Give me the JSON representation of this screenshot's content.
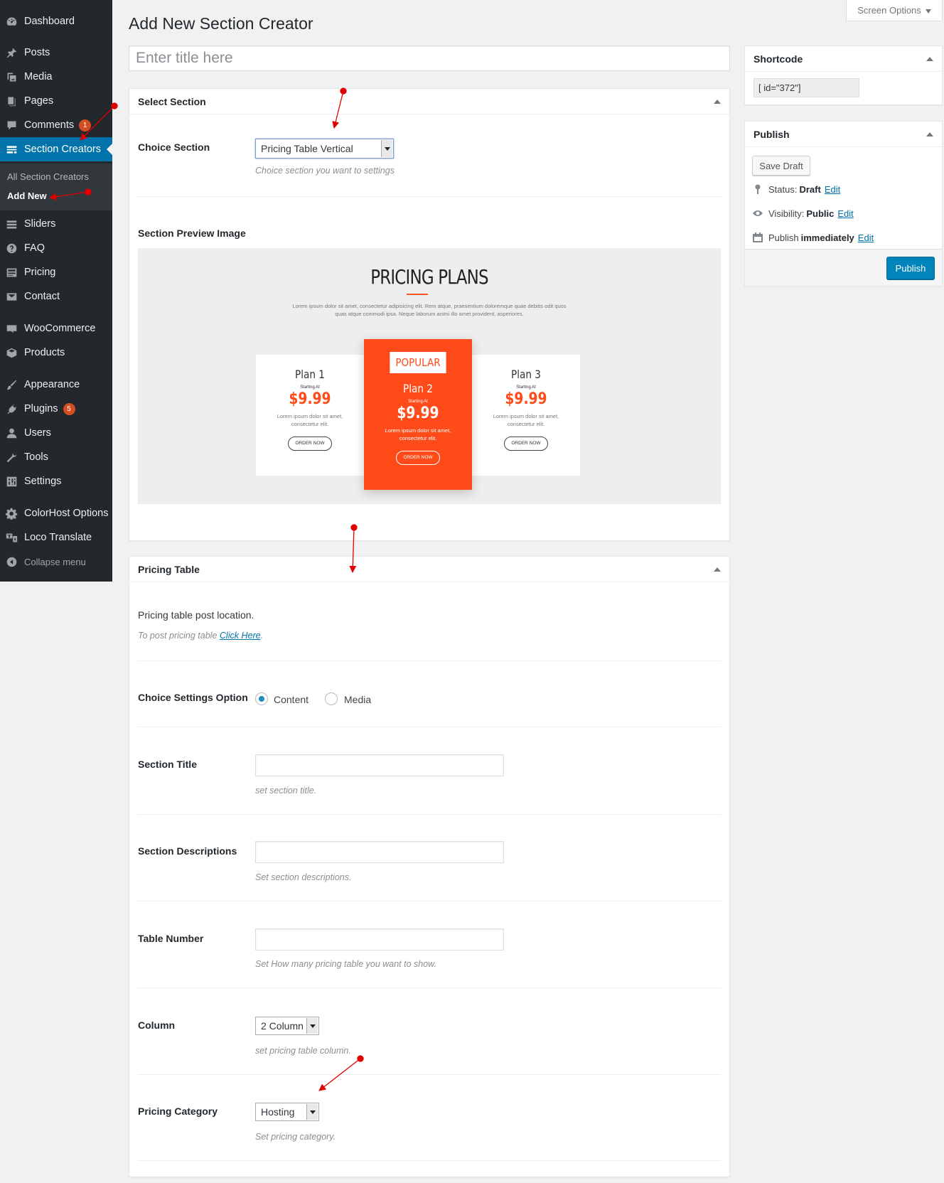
{
  "sidebar": {
    "items": [
      {
        "label": "Dashboard",
        "icon": "dashboard-icon"
      },
      {
        "label": "Posts",
        "icon": "pushpin-icon"
      },
      {
        "label": "Media",
        "icon": "media-icon"
      },
      {
        "label": "Pages",
        "icon": "pages-icon"
      },
      {
        "label": "Comments",
        "icon": "comment-icon",
        "badge": "1"
      },
      {
        "label": "Section Creators",
        "icon": "section-icon"
      },
      {
        "label": "Sliders",
        "icon": "slider-icon"
      },
      {
        "label": "FAQ",
        "icon": "question-icon"
      },
      {
        "label": "Pricing",
        "icon": "pricing-icon"
      },
      {
        "label": "Contact",
        "icon": "mail-icon"
      },
      {
        "label": "WooCommerce",
        "icon": "woo-icon"
      },
      {
        "label": "Products",
        "icon": "products-icon"
      },
      {
        "label": "Appearance",
        "icon": "brush-icon"
      },
      {
        "label": "Plugins",
        "icon": "plug-icon",
        "badge": "5"
      },
      {
        "label": "Users",
        "icon": "user-icon"
      },
      {
        "label": "Tools",
        "icon": "wrench-icon"
      },
      {
        "label": "Settings",
        "icon": "settings-icon"
      },
      {
        "label": "ColorHost Options",
        "icon": "gear-icon"
      },
      {
        "label": "Loco Translate",
        "icon": "translate-icon"
      },
      {
        "label": "Collapse menu",
        "icon": "collapse-icon"
      }
    ],
    "submenu": [
      "All Section Creators",
      "Add New"
    ]
  },
  "screen_options": "Screen Options",
  "page_title": "Add New Section Creator",
  "title_placeholder": "Enter title here",
  "select_section": {
    "heading": "Select Section",
    "label": "Choice Section",
    "value": "Pricing Table Vertical",
    "desc": "Choice section you want to settings",
    "preview_label": "Section Preview Image"
  },
  "preview": {
    "title": "PRICING PLANS",
    "desc": "Lorem ipsum dolor sit amet, consectetur adipisicing elit. Rem atque, praesentium doloremque quae debitis odit quos quas atque commodi ipsa. Neque laborum animi illo amet provident, asperiores.",
    "plans": [
      {
        "name": "Plan 1",
        "starting": "Starting At",
        "price": "$9.99",
        "desc": "Lorem ipsum dolor sit amet, consectetur elit.",
        "button": "ORDER NOW"
      },
      {
        "name": "Plan 2",
        "badge": "POPULAR",
        "starting": "Starting At",
        "price": "$9.99",
        "desc": "Lorem ipsum dolor sit amet, consectetur elit.",
        "button": "ORDER NOW"
      },
      {
        "name": "Plan 3",
        "starting": "Starting At",
        "price": "$9.99",
        "desc": "Lorem ipsum dolor sit amet, consectetur elit.",
        "button": "ORDER NOW"
      }
    ]
  },
  "pricing_table": {
    "heading": "Pricing Table",
    "location_label": "Pricing table post location.",
    "location_desc": "To post pricing table",
    "location_link": "Click Here",
    "settings_label": "Choice Settings Option",
    "option_content": "Content",
    "option_media": "Media",
    "title_label": "Section Title",
    "title_desc": "set section title.",
    "descriptions_label": "Section Descriptions",
    "descriptions_desc": "Set section descriptions.",
    "number_label": "Table Number",
    "number_desc": "Set How many pricing table you want to show.",
    "column_label": "Column",
    "column_value": "2 Column",
    "column_desc": "set pricing table column.",
    "category_label": "Pricing Category",
    "category_value": "Hosting",
    "category_desc": "Set pricing category."
  },
  "shortcode": {
    "heading": "Shortcode",
    "value": "[ id=\"372\"]"
  },
  "publish": {
    "heading": "Publish",
    "save_draft": "Save Draft",
    "status_label": "Status:",
    "status_value": "Draft",
    "visibility_label": "Visibility:",
    "visibility_value": "Public",
    "publish_label": "Publish",
    "publish_value": "immediately",
    "edit": "Edit",
    "publish_button": "Publish"
  },
  "colors": {
    "sidebar_bg": "#23282d",
    "active": "#0073aa",
    "accent_orange": "#ff4b1a",
    "annotation_red": "#e00000"
  }
}
